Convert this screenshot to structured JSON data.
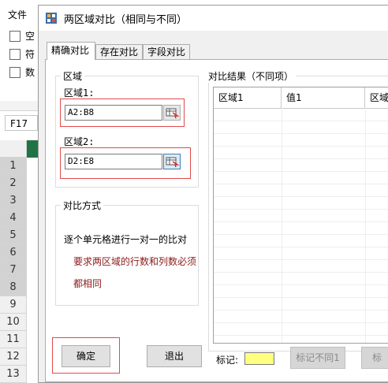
{
  "background_app": {
    "ribbon_tab": "文件",
    "checkbox_labels": [
      "空",
      "符",
      "数"
    ],
    "name_box": "F17",
    "row_numbers": [
      "1",
      "2",
      "3",
      "4",
      "5",
      "6",
      "7",
      "8",
      "9",
      "10",
      "11",
      "12",
      "13"
    ]
  },
  "dialog": {
    "title": "两区域对比（相同与不同）",
    "tabs": [
      "精确对比",
      "存在对比",
      "字段对比"
    ],
    "region_group": {
      "legend": "区域",
      "region1_label": "区域1:",
      "region1_value": "A2:B8",
      "region2_label": "区域2:",
      "region2_value": "D2:E8"
    },
    "method_group": {
      "legend": "对比方式",
      "line1": "逐个单元格进行一对一的比对",
      "line2": "要求两区域的行数和列数必须",
      "line3": "都相同"
    },
    "result_group": {
      "legend": "对比结果（不同项）",
      "columns": [
        "区域1",
        "值1",
        "区域"
      ]
    },
    "buttons": {
      "ok": "确定",
      "exit": "退出",
      "mark_diff1": "标记不同1",
      "mark_diff2": "标"
    },
    "mark_label": "标记:",
    "colors": {
      "mark_swatch": "#ffff80",
      "highlight_red": "#e24a4a",
      "excel_green": "#217346"
    }
  }
}
